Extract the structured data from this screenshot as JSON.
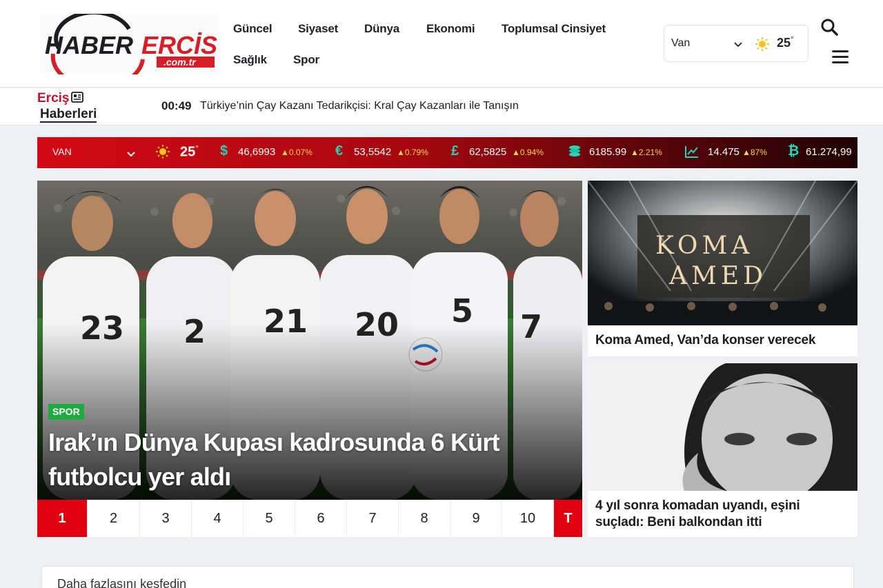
{
  "site": {
    "logo_text_main": "HABER ERCİS",
    "logo_text_sub": ".com.tr"
  },
  "nav": {
    "items": [
      "Güncel",
      "Siyaset",
      "Dünya",
      "Ekonomi",
      "Toplumsal Cinsiyet",
      "Sağlık",
      "Spor"
    ]
  },
  "weather": {
    "city": "Van",
    "temp": "25",
    "deg": "°"
  },
  "ticker": {
    "label_line1": "Erciş",
    "label_line2": "Haberleri",
    "time": "00:49",
    "headline": "Türkiye’nin Çay Kazanı Tedarikçisi: Kral Çay Kazanları ile Tanışın"
  },
  "market": {
    "city": "VAN",
    "temp": "25",
    "deg": "°",
    "items": [
      {
        "icon": "dollar-icon",
        "symbol": "$",
        "value": "46,6993",
        "change": "▲0.07%"
      },
      {
        "icon": "euro-icon",
        "symbol": "€",
        "value": "53,5542",
        "change": "▲0.79%"
      },
      {
        "icon": "pound-icon",
        "symbol": "£",
        "value": "62,5825",
        "change": "▲0.94%"
      },
      {
        "icon": "gold-coins-icon",
        "symbol": "◎",
        "value": "6185.99",
        "change": "▲2.21%"
      },
      {
        "icon": "stock-chart-icon",
        "symbol": "⟋",
        "value": "14.475",
        "change": "▲87%"
      },
      {
        "icon": "bitcoin-icon",
        "symbol": "₿",
        "value": "61.274,99",
        "change": ""
      }
    ],
    "accent_change_color": "#f6d84a",
    "icon_color": "#24d6b8"
  },
  "slider": {
    "category": "SPOR",
    "title": "Irak’ın Dünya Kupası kadrosunda 6 Kürt futbolcu yer aldı",
    "jersey_numbers": [
      "23",
      "2",
      "21",
      "20",
      "5",
      "7"
    ],
    "pages": [
      "1",
      "2",
      "3",
      "4",
      "5",
      "6",
      "7",
      "8",
      "9",
      "10"
    ],
    "active_page": "1",
    "tab_label": "T"
  },
  "cards": [
    {
      "title": "Koma Amed, Van’da konser verecek",
      "image_text": "KOMA AMED"
    },
    {
      "title": "4 yıl sonra komadan uyandı, eşini suçladı: Beni balkondan itti"
    }
  ],
  "discover": {
    "label": "Daha fazlasını keşfedin"
  },
  "colors": {
    "brand_red": "#e0000f",
    "badge_green": "#1eab3f"
  }
}
